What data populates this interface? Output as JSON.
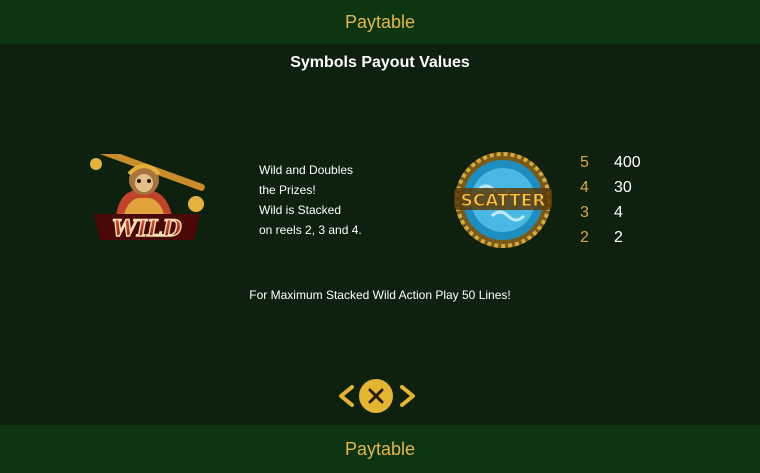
{
  "header": {
    "title": "Paytable"
  },
  "section_title": "Symbols Payout Values",
  "wild": {
    "label": "WILD",
    "icon": "monkey-king-wild-icon",
    "description": [
      "Wild and Doubles",
      "the Prizes!",
      "Wild is Stacked",
      "on reels 2, 3 and 4."
    ]
  },
  "scatter": {
    "label": "SCATTER",
    "icon": "scatter-medallion-icon",
    "payouts": [
      {
        "count": "5",
        "value": "400"
      },
      {
        "count": "4",
        "value": "30"
      },
      {
        "count": "3",
        "value": "4"
      },
      {
        "count": "2",
        "value": "2"
      }
    ]
  },
  "note": "For Maximum Stacked Wild Action Play 50 Lines!",
  "nav": {
    "prev_icon": "chevron-left-icon",
    "close_icon": "close-icon",
    "next_icon": "chevron-right-icon"
  },
  "footer": {
    "title": "Paytable"
  },
  "colors": {
    "background": "#0e200e",
    "bar": "#0d3512",
    "gold": "#e3b64a",
    "text": "#ffffff"
  }
}
